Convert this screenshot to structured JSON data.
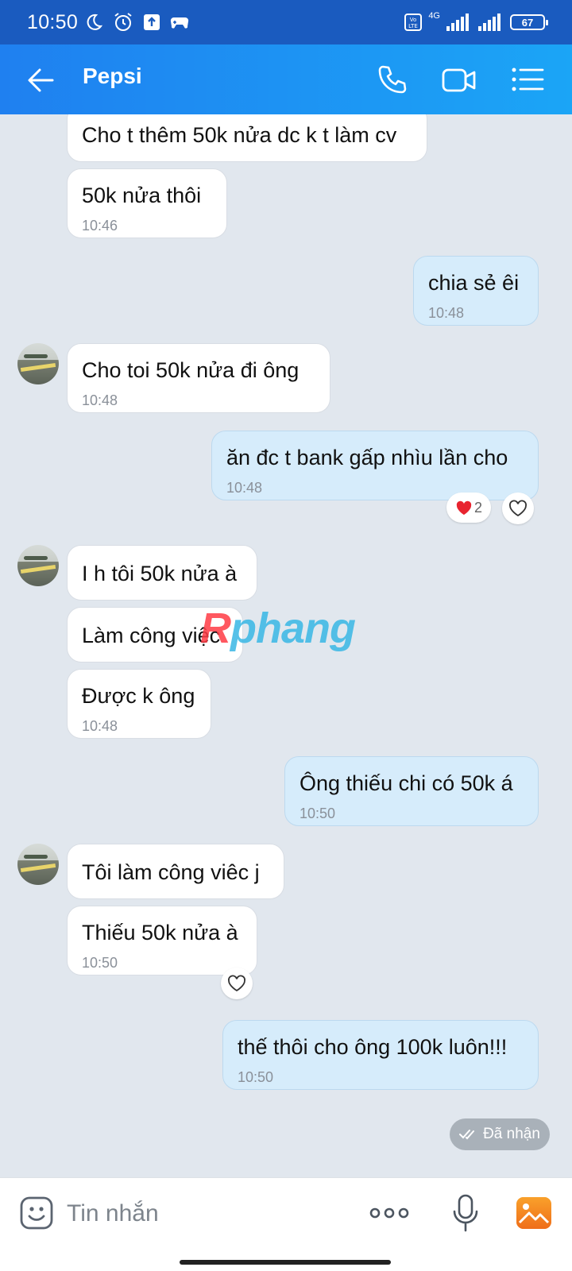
{
  "status_bar": {
    "time": "10:50",
    "battery": "67",
    "network": "4G"
  },
  "header": {
    "title": "Pepsi"
  },
  "messages": [
    {
      "text": "Cho t thêm 50k nửa dc k t làm cv",
      "time": ""
    },
    {
      "text": "50k nửa thôi",
      "time": "10:46"
    },
    {
      "text": "chia sẻ êi",
      "time": "10:48"
    },
    {
      "text": "Cho toi 50k nửa đi ông",
      "time": "10:48"
    },
    {
      "text": "ăn đc t bank gấp nhìu lần cho",
      "time": "10:48",
      "reaction_count": "2"
    },
    {
      "text": "I h tôi 50k nửa à",
      "time": ""
    },
    {
      "text": "Làm công việc",
      "time": ""
    },
    {
      "text": "Được k ông",
      "time": "10:48"
    },
    {
      "text": "Ông thiếu chi có 50k á",
      "time": "10:50"
    },
    {
      "text": "Tôi làm công viêc j",
      "time": ""
    },
    {
      "text": "Thiếu 50k nửa à",
      "time": "10:50"
    },
    {
      "text": "thế thôi cho ông 100k luôn!!!",
      "time": "10:50"
    }
  ],
  "delivery_status": "Đã nhận",
  "watermark": "Rphang",
  "input": {
    "placeholder": "Tin nhắn"
  },
  "colors": {
    "header_start": "#1f80f0",
    "header_end": "#1ba5f6",
    "outgoing": "#d6ecfb",
    "incoming": "#ffffff",
    "background": "#e1e7ee"
  }
}
